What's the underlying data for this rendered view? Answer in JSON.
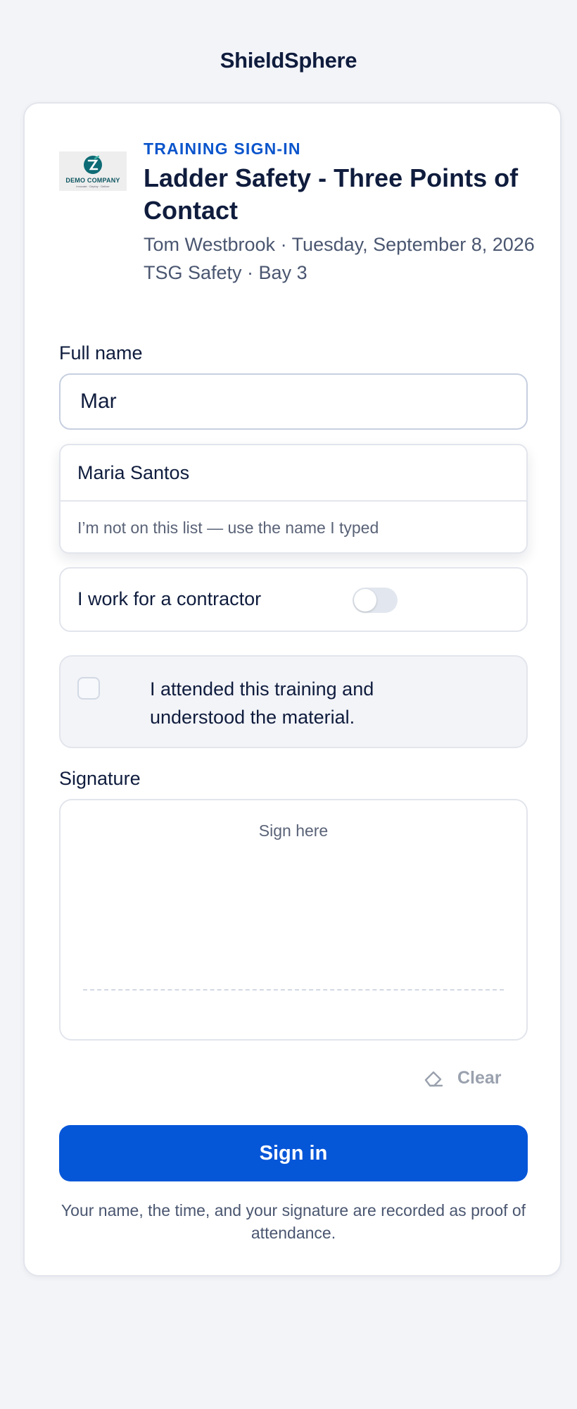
{
  "app": {
    "brand": "ShieldSphere"
  },
  "header": {
    "logo_text": "DEMO COMPANY",
    "logo_tagline": "Innovate · Deploy · Deliver",
    "eyebrow": "TRAINING SIGN-IN",
    "title": "Ladder Safety - Three Points of Contact",
    "meta_line1": "Tom Westbrook · Tuesday, September 8, 2026",
    "meta_line2": "TSG Safety · Bay 3"
  },
  "form": {
    "full_name": {
      "label": "Full name",
      "value": "Mar",
      "suggestions": [
        "Maria Santos"
      ],
      "fallback_option": "I’m not on this list — use the name I typed"
    },
    "contractor": {
      "label": "I work for a contractor",
      "enabled": false
    },
    "attestation": {
      "label": "I attended this training and understood the material.",
      "checked": false
    },
    "signature": {
      "label": "Signature",
      "hint": "Sign here",
      "clear_label": "Clear"
    },
    "submit_label": "Sign in",
    "footnote": "Your name, the time, and your signature are recorded as proof of attendance."
  },
  "colors": {
    "accent": "#0656d8",
    "eyebrow": "#0b55cc",
    "text": "#0f1c3d",
    "muted": "#4a5670",
    "background": "#f3f4f8"
  }
}
